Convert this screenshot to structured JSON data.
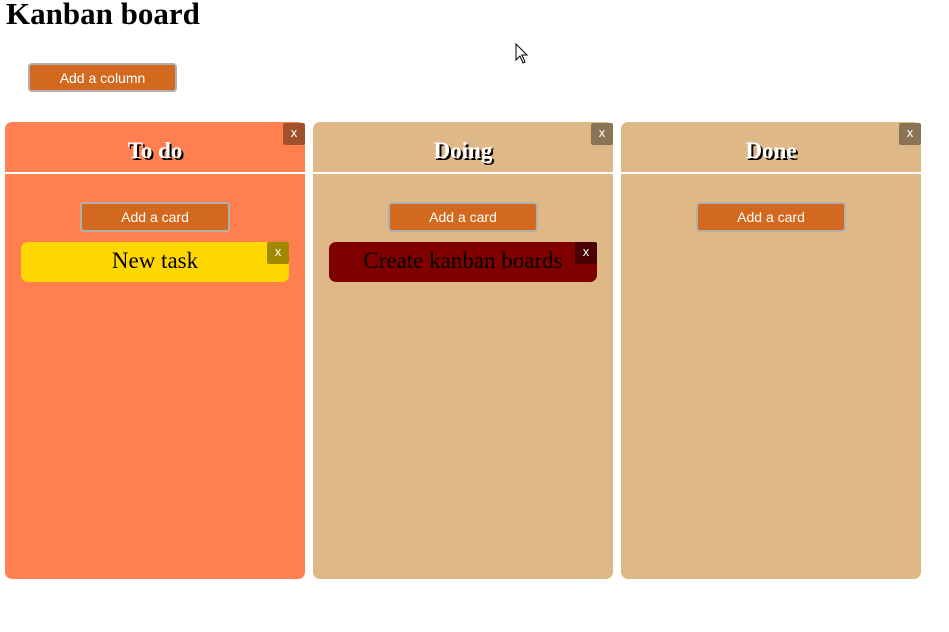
{
  "page": {
    "title": "Kanban board",
    "add_column_label": "Add a column"
  },
  "colors": {
    "button": "#d2691e",
    "todo_column": "#ff7f50",
    "default_column": "#deb887",
    "todo_card": "#ffd700",
    "doing_card": "#800000",
    "todo_column_close": "#a0522d",
    "default_column_close": "#8b7355",
    "todo_card_close": "#a08800",
    "doing_card_close": "#4a0000"
  },
  "columns": [
    {
      "title": "To do",
      "close_label": "x",
      "add_card_label": "Add a card",
      "cards": [
        {
          "text": "New task",
          "close_label": "x"
        }
      ]
    },
    {
      "title": "Doing",
      "close_label": "x",
      "add_card_label": "Add a card",
      "cards": [
        {
          "text": "Create kanban boards",
          "close_label": "x"
        }
      ]
    },
    {
      "title": "Done",
      "close_label": "x",
      "add_card_label": "Add a card",
      "cards": []
    }
  ]
}
